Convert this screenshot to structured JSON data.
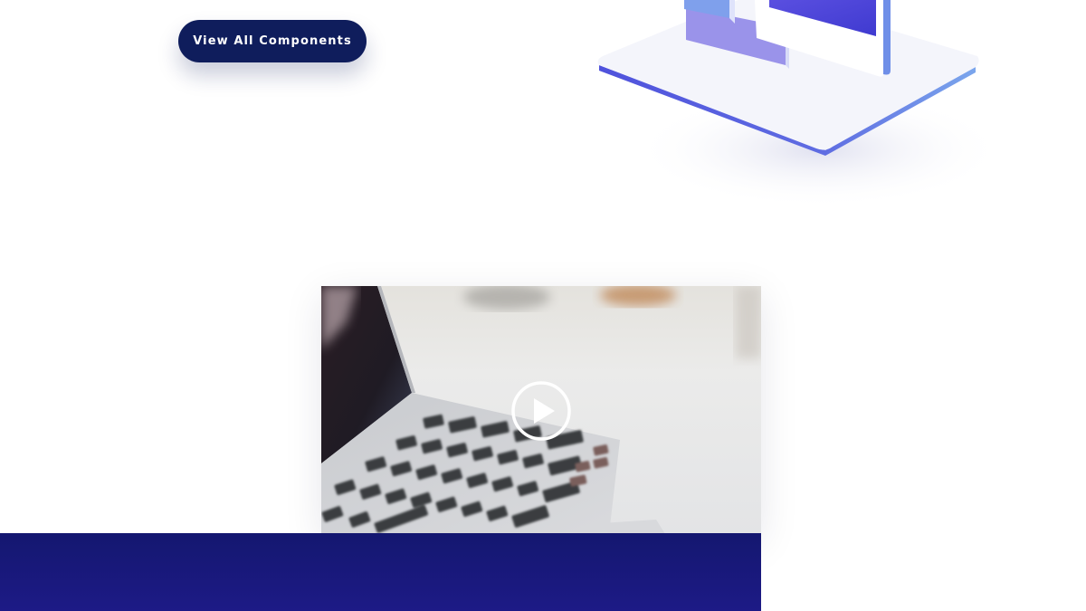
{
  "hero": {
    "cta_label": "View All Components"
  },
  "illustration": {
    "icon": "isometric-devices-illustration",
    "colors": {
      "platform": "#f4f5fb",
      "edge": "#5559e0",
      "edge_light": "#7fa2ee",
      "screen": "#4b44d8"
    }
  },
  "video": {
    "thumbnail_icon": "laptop-keyboard-photo",
    "play_icon": "play-icon"
  },
  "colors": {
    "navy": "#0f1d5c",
    "band": "#161877"
  }
}
